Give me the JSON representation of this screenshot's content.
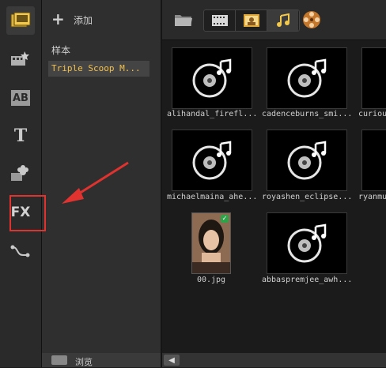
{
  "leftbar": {
    "items": [
      {
        "name": "media-icon"
      },
      {
        "name": "instant-project-icon"
      },
      {
        "name": "transition-icon",
        "text": "AB"
      },
      {
        "name": "title-icon",
        "text": "T"
      },
      {
        "name": "graphic-icon"
      },
      {
        "name": "filter-icon",
        "text": "FX"
      },
      {
        "name": "path-icon"
      }
    ]
  },
  "library": {
    "add_label": "添加",
    "sample_label": "样本",
    "folder_label": "Triple Scoop M...",
    "browse_label": "浏览"
  },
  "grid": {
    "items": [
      {
        "label": "alihandal_firefl..."
      },
      {
        "label": "cadenceburns_smi..."
      },
      {
        "label": "curiou"
      },
      {
        "label": "michaelmaina_ahe..."
      },
      {
        "label": "royashen_eclipse..."
      },
      {
        "label": "ryanmu"
      },
      {
        "label": "00.jpg"
      },
      {
        "label": "abbaspremjee_awh..."
      }
    ]
  },
  "colors": {
    "annotation": "#e0322e",
    "folder_text": "#f2c14e"
  }
}
